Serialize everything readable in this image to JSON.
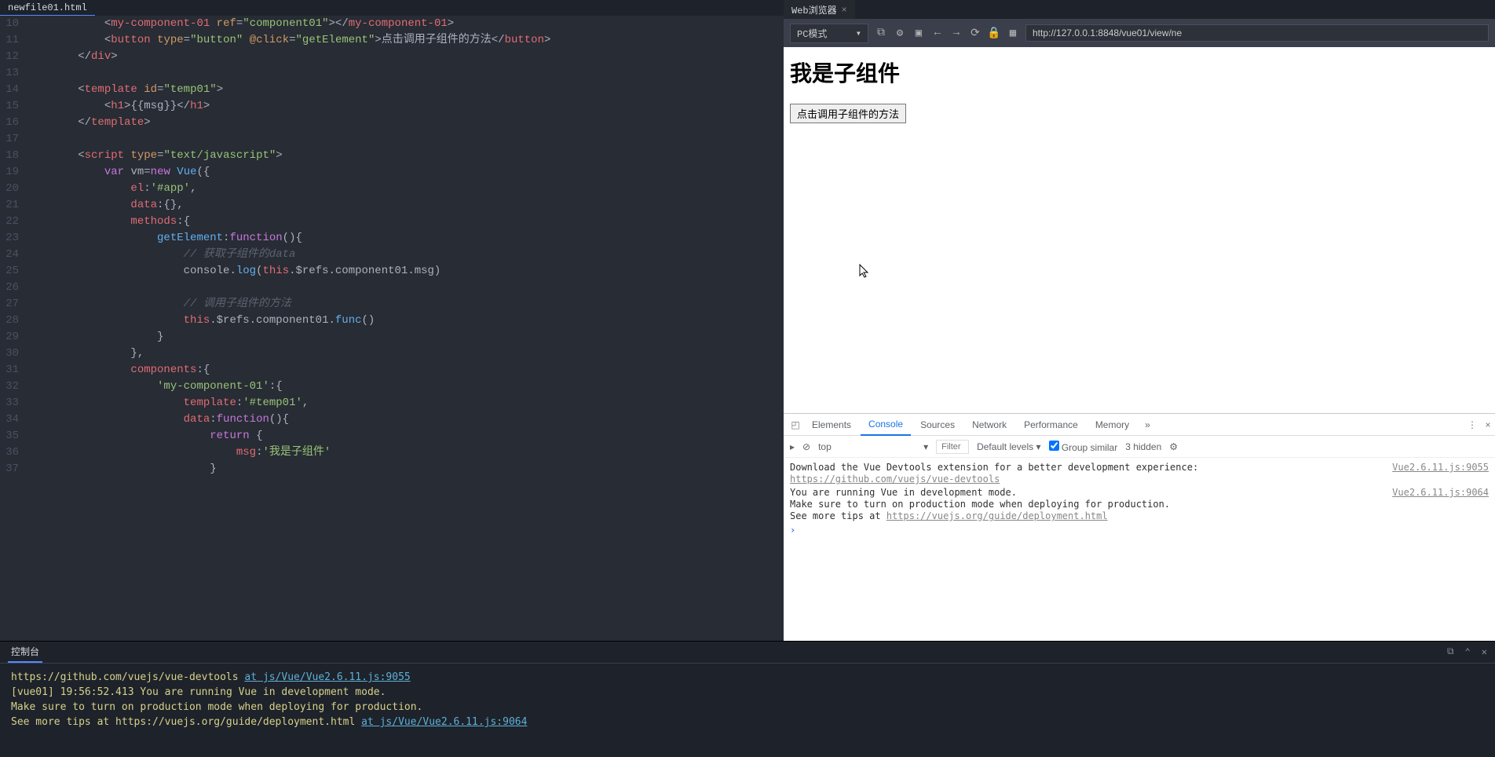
{
  "editor": {
    "tab_title": "newfile01.html",
    "lines": {
      "start": 10,
      "end": 37
    }
  },
  "browser": {
    "tab_title": "Web浏览器",
    "mode": "PC模式",
    "url": "http://127.0.0.1:8848/vue01/view/ne"
  },
  "preview": {
    "heading": "我是子组件",
    "button_label": "点击调用子组件的方法"
  },
  "devtools": {
    "tabs": [
      "Elements",
      "Console",
      "Sources",
      "Network",
      "Performance",
      "Memory"
    ],
    "active_tab": "Console",
    "context": "top",
    "filter_placeholder": "Filter",
    "levels_label": "Default levels ▾",
    "group_similar": "Group similar",
    "hidden_count": "3 hidden",
    "messages": [
      {
        "text": "Download the Vue Devtools extension for a better development experience:",
        "link": "https://github.com/vuejs/vue-devtools",
        "source": "Vue2.6.11.js:9055"
      },
      {
        "text": "You are running Vue in development mode.\nMake sure to turn on production mode when deploying for production.\nSee more tips at ",
        "link": "https://vuejs.org/guide/deployment.html",
        "source": "Vue2.6.11.js:9064"
      }
    ]
  },
  "bottom_console": {
    "title": "控制台",
    "line1_pre": "https://github.com/vuejs/vue-devtools",
    "line1_link": "at js/Vue/Vue2.6.11.js:9055",
    "line2": "[vue01] 19:56:52.413",
    "line2b": "You are running Vue in development mode.",
    "line3": "Make sure to turn on production mode when deploying for production.",
    "line4": "See more tips at https://vuejs.org/guide/deployment.html",
    "line4_link": "at js/Vue/Vue2.6.11.js:9064"
  }
}
